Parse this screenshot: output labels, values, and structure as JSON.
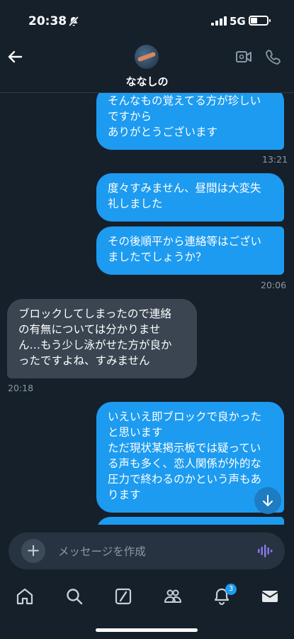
{
  "status_bar": {
    "time": "20:38",
    "network": "5G"
  },
  "header": {
    "contact_name": "ななしの"
  },
  "messages": [
    {
      "dir": "out",
      "lines": [
        "そんなもの覚えてる方が珍しい",
        "ですから",
        "ありがとうございます"
      ],
      "time": "13:21"
    },
    {
      "dir": "out",
      "lines": [
        "度々すみません、昼間は大変失",
        "礼しました"
      ],
      "time": ""
    },
    {
      "dir": "out",
      "lines": [
        "その後順平から連絡等はござい",
        "ましたでしょうか？"
      ],
      "time": "20:06"
    },
    {
      "dir": "in",
      "lines": [
        "ブロックしてしまったので連絡",
        "の有無については分かりませ",
        "ん…もう少し泳がせた方が良か",
        "ったですよね、すみません"
      ],
      "time": "20:18"
    },
    {
      "dir": "out",
      "lines": [
        "いえいえ即ブロックで良かった",
        "と思います",
        "ただ現状某掲示板では疑ってい",
        "る声も多く、恋人関係が外的な",
        "圧力で終わるのかという声もあ",
        "ります"
      ],
      "time": ""
    }
  ],
  "composer": {
    "placeholder": "メッセージを作成"
  },
  "tabbar": {
    "notifications_badge": "3"
  },
  "colors": {
    "background": "#15202b",
    "outgoing_bubble": "#1d9bf0",
    "incoming_bubble": "#3a4551",
    "accent": "#1d9bf0"
  }
}
